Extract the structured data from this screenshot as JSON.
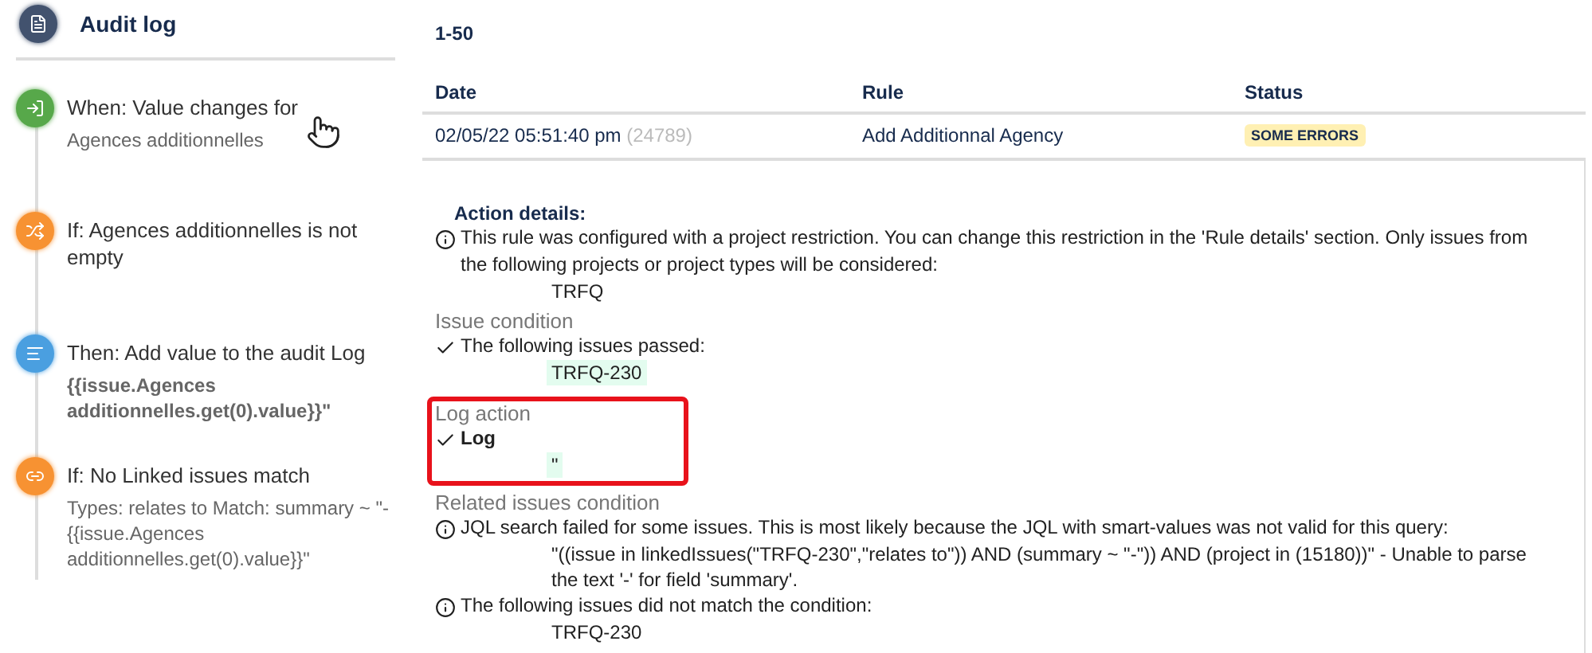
{
  "sidebar": {
    "title": "Audit log",
    "steps": [
      {
        "kind": "trigger",
        "title": "When: Value changes for",
        "detail": "Agences additionnelles",
        "detail_bold": false
      },
      {
        "kind": "condition",
        "title": "If: Agences additionnelles is not empty"
      },
      {
        "kind": "action",
        "title": "Then: Add value to the audit Log",
        "detail": "{{issue.Agences additionnelles.get(0).value}}\"",
        "detail_bold": true
      },
      {
        "kind": "branch",
        "title": "If: No Linked issues match",
        "detail": "Types: relates to Match: summary ~ \"-{{issue.Agences additionnelles.get(0).value}}\"",
        "detail_bold": false
      }
    ]
  },
  "main": {
    "range": "1-50",
    "columns": [
      "Date",
      "Rule",
      "Status"
    ],
    "rows": [
      {
        "date": "02/05/22 05:51:40 pm",
        "id": "(24789)",
        "rule": "Add Additionnal Agency",
        "status": "SOME ERRORS"
      }
    ],
    "details": {
      "title": "Action details:",
      "note": {
        "kind": "info",
        "bold": false,
        "text": "This rule was configured with a project restriction. You can change this restriction in the 'Rule details' section. Only issues from the following projects or project types will be considered:",
        "values": [
          {
            "text": "TRFQ",
            "highlighted": false
          }
        ]
      },
      "sections": [
        {
          "heading": "Issue condition",
          "highlighted": false,
          "items": [
            {
              "kind": "check",
              "text": "The following issues passed:",
              "bold": false,
              "values": [
                {
                  "text": "TRFQ-230",
                  "highlighted": true
                }
              ]
            }
          ]
        },
        {
          "heading": "Log action",
          "highlighted": true,
          "items": [
            {
              "kind": "check",
              "text": "Log",
              "bold": true,
              "values": [
                {
                  "text": "\"",
                  "highlighted": true
                }
              ]
            }
          ]
        },
        {
          "heading": "Related issues condition",
          "highlighted": false,
          "items": [
            {
              "kind": "info",
              "text": "JQL search failed for some issues. This is most likely because the JQL with smart-values was not valid for this query:",
              "bold": false,
              "values": [
                {
                  "text": "\"((issue in linkedIssues(\"TRFQ-230\",\"relates to\")) AND (summary ~ \"-\")) AND (project in (15180))\" - Unable to parse the text '-' for field 'summary'.",
                  "highlighted": false
                }
              ]
            },
            {
              "kind": "info",
              "text": "The following issues did not match the condition:",
              "bold": false,
              "values": [
                {
                  "text": "TRFQ-230",
                  "highlighted": false
                }
              ]
            }
          ]
        }
      ]
    }
  }
}
